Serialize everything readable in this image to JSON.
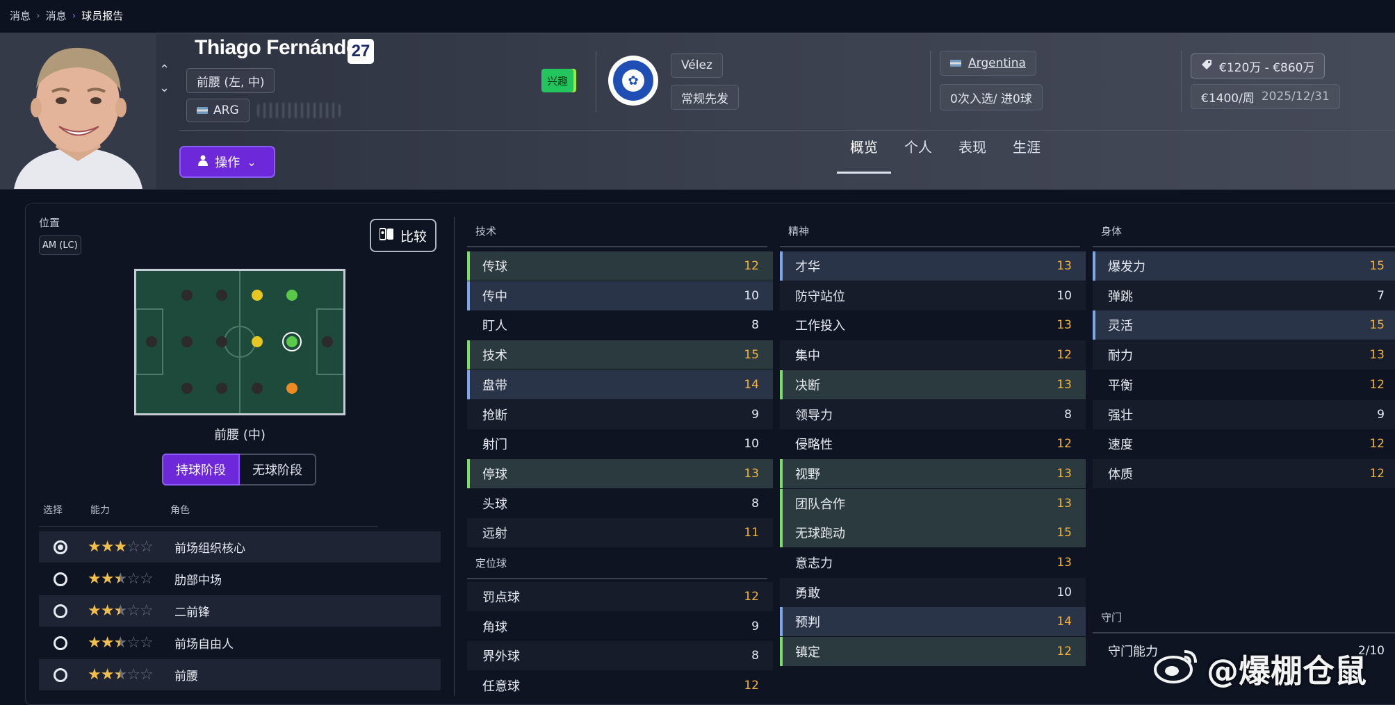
{
  "breadcrumb": [
    "消息",
    "消息",
    "球员报告"
  ],
  "player": {
    "name": "Thiago Fernández",
    "number": "27",
    "position": "前腰 (左, 中)",
    "nation_code": "ARG",
    "action_label": "操作",
    "interest_label": "兴趣"
  },
  "club": {
    "name": "Vélez",
    "squad_status": "常规先发",
    "country": "Argentina",
    "apps": "0次入选/ 进0球"
  },
  "contract": {
    "value_range": "€120万 - €860万",
    "wage": "€1400/周",
    "expiry": "2025/12/31"
  },
  "tabs": [
    "概览",
    "个人",
    "表现",
    "生涯"
  ],
  "position_panel": {
    "label": "位置",
    "code": "AM (LC)",
    "compare_label": "比较",
    "pitch_label": "前腰 (中)",
    "phase_in": "持球阶段",
    "phase_out": "无球阶段",
    "col_select": "选择",
    "col_ability": "能力",
    "col_role": "角色"
  },
  "roles": [
    {
      "name": "前场组织核心",
      "stars": 3,
      "selected": true
    },
    {
      "name": "肋部中场",
      "stars": 2.5,
      "selected": false
    },
    {
      "name": "二前锋",
      "stars": 2.5,
      "selected": false
    },
    {
      "name": "前场自由人",
      "stars": 2.5,
      "selected": false
    },
    {
      "name": "前腰",
      "stars": 2.5,
      "selected": false
    }
  ],
  "sections": {
    "technical": "技术",
    "setpieces": "定位球",
    "mental": "精神",
    "physical": "身体",
    "goalkeeping": "守门"
  },
  "technical": [
    {
      "name": "传球",
      "value": "12"
    },
    {
      "name": "传中",
      "value": "10"
    },
    {
      "name": "盯人",
      "value": "8"
    },
    {
      "name": "技术",
      "value": "15"
    },
    {
      "name": "盘带",
      "value": "14"
    },
    {
      "name": "抢断",
      "value": "9"
    },
    {
      "name": "射门",
      "value": "10"
    },
    {
      "name": "停球",
      "value": "13"
    },
    {
      "name": "头球",
      "value": "8"
    },
    {
      "name": "远射",
      "value": "11"
    }
  ],
  "setpieces": [
    {
      "name": "罚点球",
      "value": "12"
    },
    {
      "name": "角球",
      "value": "9"
    },
    {
      "name": "界外球",
      "value": "8"
    },
    {
      "name": "任意球",
      "value": "12"
    }
  ],
  "mental": [
    {
      "name": "才华",
      "value": "13"
    },
    {
      "name": "防守站位",
      "value": "10"
    },
    {
      "name": "工作投入",
      "value": "13"
    },
    {
      "name": "集中",
      "value": "12"
    },
    {
      "name": "决断",
      "value": "13"
    },
    {
      "name": "领导力",
      "value": "8"
    },
    {
      "name": "侵略性",
      "value": "12"
    },
    {
      "name": "视野",
      "value": "13"
    },
    {
      "name": "团队合作",
      "value": "13"
    },
    {
      "name": "无球跑动",
      "value": "15"
    },
    {
      "name": "意志力",
      "value": "13"
    },
    {
      "name": "勇敢",
      "value": "10"
    },
    {
      "name": "预判",
      "value": "14"
    },
    {
      "name": "镇定",
      "value": "12"
    }
  ],
  "physical": [
    {
      "name": "爆发力",
      "value": "15"
    },
    {
      "name": "弹跳",
      "value": "7"
    },
    {
      "name": "灵活",
      "value": "15"
    },
    {
      "name": "耐力",
      "value": "13"
    },
    {
      "name": "平衡",
      "value": "12"
    },
    {
      "name": "强壮",
      "value": "9"
    },
    {
      "name": "速度",
      "value": "12"
    },
    {
      "name": "体质",
      "value": "12"
    }
  ],
  "goalkeeping": [
    {
      "name": "守门能力",
      "value": "2/10"
    }
  ],
  "watermark": "@爆棚仓鼠",
  "colors": {
    "accent": "#6d28d9",
    "high_value": "#f4b43c",
    "pitch": "#1d4a3b"
  }
}
